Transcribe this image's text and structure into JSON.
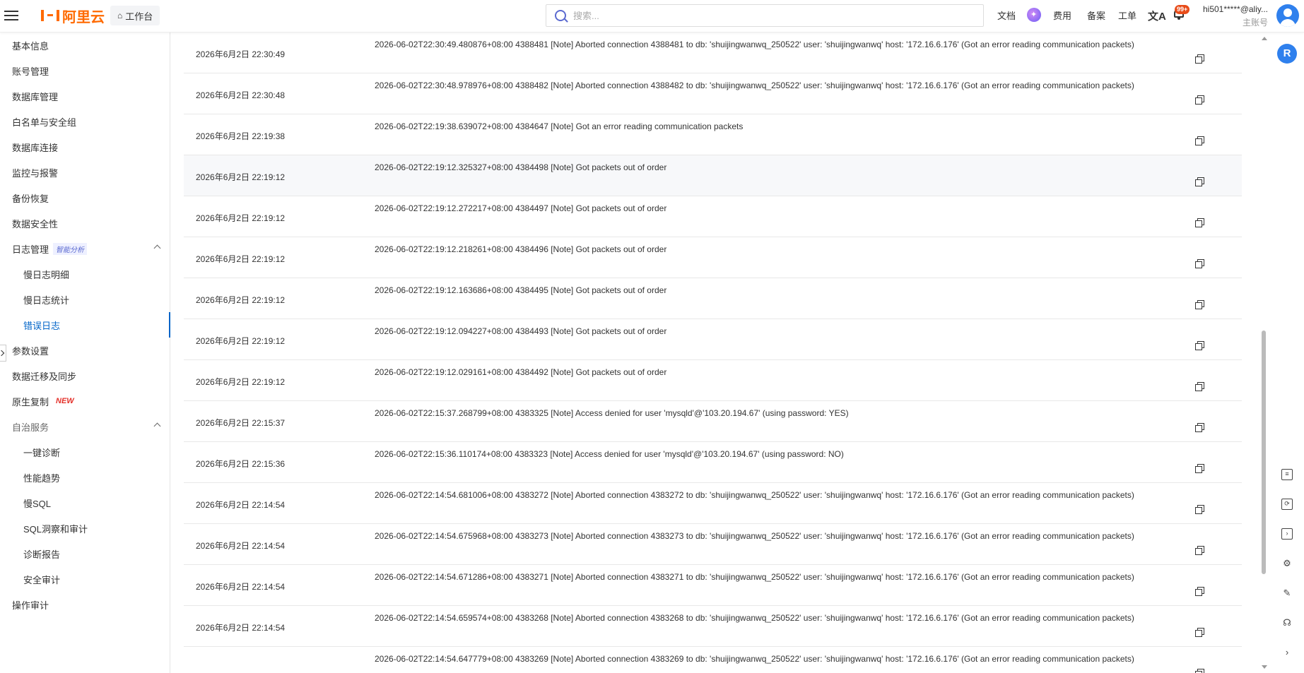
{
  "topbar": {
    "logo": "阿里云",
    "workbench": "工作台",
    "search_placeholder": "搜索...",
    "docs": "文档",
    "cost": "费用",
    "beian": "备案",
    "ticket": "工单",
    "badge": "99+",
    "user_name": "hi501*****@aliy...",
    "user_role": "主账号"
  },
  "sidebar": {
    "items": [
      {
        "label": "基本信息"
      },
      {
        "label": "账号管理"
      },
      {
        "label": "数据库管理"
      },
      {
        "label": "白名单与安全组"
      },
      {
        "label": "数据库连接"
      },
      {
        "label": "监控与报警"
      },
      {
        "label": "备份恢复"
      },
      {
        "label": "数据安全性"
      },
      {
        "label": "日志管理",
        "tag": "智能分析"
      },
      {
        "label": "慢日志明细"
      },
      {
        "label": "慢日志统计"
      },
      {
        "label": "错误日志"
      },
      {
        "label": "参数设置"
      },
      {
        "label": "数据迁移及同步"
      },
      {
        "label": "原生复制",
        "tag": "NEW"
      },
      {
        "label": "自治服务"
      },
      {
        "label": "一键诊断"
      },
      {
        "label": "性能趋势"
      },
      {
        "label": "慢SQL"
      },
      {
        "label": "SQL洞察和审计"
      },
      {
        "label": "诊断报告"
      },
      {
        "label": "安全审计"
      },
      {
        "label": "操作审计"
      }
    ]
  },
  "logs": [
    {
      "time": "2026年6月2日 22:30:49",
      "msg": "2026-06-02T22:30:49.480876+08:00 4388481 [Note] Aborted connection 4388481 to db: 'shuijingwanwq_250522' user: 'shuijingwanwq' host: '172.16.6.176' (Got an error reading communication packets)"
    },
    {
      "time": "2026年6月2日 22:30:48",
      "msg": "2026-06-02T22:30:48.978976+08:00 4388482 [Note] Aborted connection 4388482 to db: 'shuijingwanwq_250522' user: 'shuijingwanwq' host: '172.16.6.176' (Got an error reading communication packets)"
    },
    {
      "time": "2026年6月2日 22:19:38",
      "msg": "2026-06-02T22:19:38.639072+08:00 4384647 [Note] Got an error reading communication packets"
    },
    {
      "time": "2026年6月2日 22:19:12",
      "msg": "2026-06-02T22:19:12.325327+08:00 4384498 [Note] Got packets out of order"
    },
    {
      "time": "2026年6月2日 22:19:12",
      "msg": "2026-06-02T22:19:12.272217+08:00 4384497 [Note] Got packets out of order"
    },
    {
      "time": "2026年6月2日 22:19:12",
      "msg": "2026-06-02T22:19:12.218261+08:00 4384496 [Note] Got packets out of order"
    },
    {
      "time": "2026年6月2日 22:19:12",
      "msg": "2026-06-02T22:19:12.163686+08:00 4384495 [Note] Got packets out of order"
    },
    {
      "time": "2026年6月2日 22:19:12",
      "msg": "2026-06-02T22:19:12.094227+08:00 4384493 [Note] Got packets out of order"
    },
    {
      "time": "2026年6月2日 22:19:12",
      "msg": "2026-06-02T22:19:12.029161+08:00 4384492 [Note] Got packets out of order"
    },
    {
      "time": "2026年6月2日 22:15:37",
      "msg": "2026-06-02T22:15:37.268799+08:00 4383325 [Note] Access denied for user 'mysqld'@'103.20.194.67' (using password: YES)"
    },
    {
      "time": "2026年6月2日 22:15:36",
      "msg": "2026-06-02T22:15:36.110174+08:00 4383323 [Note] Access denied for user 'mysqld'@'103.20.194.67' (using password: NO)"
    },
    {
      "time": "2026年6月2日 22:14:54",
      "msg": "2026-06-02T22:14:54.681006+08:00 4383272 [Note] Aborted connection 4383272 to db: 'shuijingwanwq_250522' user: 'shuijingwanwq' host: '172.16.6.176' (Got an error reading communication packets)"
    },
    {
      "time": "2026年6月2日 22:14:54",
      "msg": "2026-06-02T22:14:54.675968+08:00 4383273 [Note] Aborted connection 4383273 to db: 'shuijingwanwq_250522' user: 'shuijingwanwq' host: '172.16.6.176' (Got an error reading communication packets)"
    },
    {
      "time": "2026年6月2日 22:14:54",
      "msg": "2026-06-02T22:14:54.671286+08:00 4383271 [Note] Aborted connection 4383271 to db: 'shuijingwanwq_250522' user: 'shuijingwanwq' host: '172.16.6.176' (Got an error reading communication packets)"
    },
    {
      "time": "2026年6月2日 22:14:54",
      "msg": "2026-06-02T22:14:54.659574+08:00 4383268 [Note] Aborted connection 4383268 to db: 'shuijingwanwq_250522' user: 'shuijingwanwq' host: '172.16.6.176' (Got an error reading communication packets)"
    },
    {
      "time": "",
      "msg": "2026-06-02T22:14:54.647779+08:00 4383269 [Note] Aborted connection 4383269 to db: 'shuijingwanwq_250522' user: 'shuijingwanwq' host: '172.16.6.176' (Got an error reading communication packets)"
    }
  ],
  "rail": {
    "assistant_glyph": "R"
  },
  "colors": {
    "brand": "#ff6a00",
    "accent": "#0064c8",
    "new_tag": "#e4322b"
  }
}
